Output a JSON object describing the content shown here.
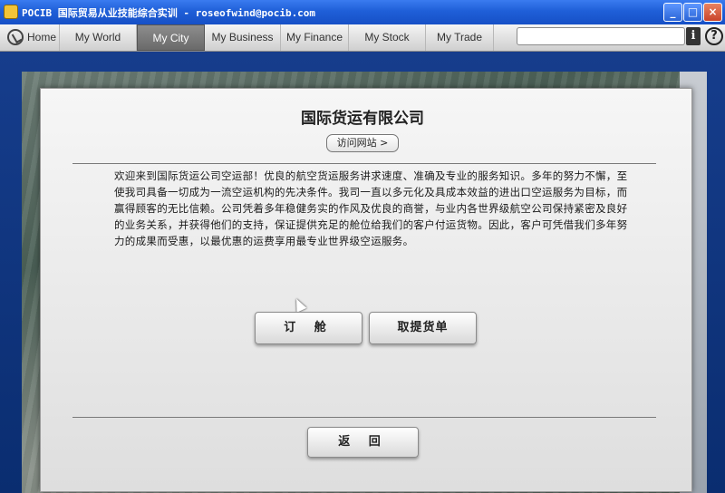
{
  "window": {
    "title": "POCIB 国际贸易从业技能综合实训 - roseofwind@pocib.com",
    "minimize": "_",
    "maximize": "□",
    "close": "×"
  },
  "nav": {
    "home": "Home",
    "items": [
      "My World",
      "My City",
      "My Business",
      "My Finance",
      "My Stock",
      "My Trade"
    ],
    "active": "My City",
    "search_value": "",
    "info_glyph": "i",
    "help_glyph": "?"
  },
  "dialog": {
    "company_name": "国际货运有限公司",
    "visit_button": "访问网站 >",
    "intro_text": "欢迎来到国际货运公司空运部！优良的航空货运服务讲求速度、准确及专业的服务知识。多年的努力不懈，至使我司具备一切成为一流空运机构的先决条件。我司一直以多元化及具成本效益的进出口空运服务为目标，而赢得顾客的无比信赖。公司凭着多年稳健务实的作风及优良的商誉，与业内各世界级航空公司保持紧密及良好的业务关系，并获得他们的支持，保证提供充足的舱位给我们的客户付运货物。因此，客户可凭借我们多年努力的成果而受惠，以最优惠的运费享用最专业世界级空运服务。",
    "book_button": "订 舱",
    "pickup_button": "取提货单",
    "back_button": "返 回"
  }
}
